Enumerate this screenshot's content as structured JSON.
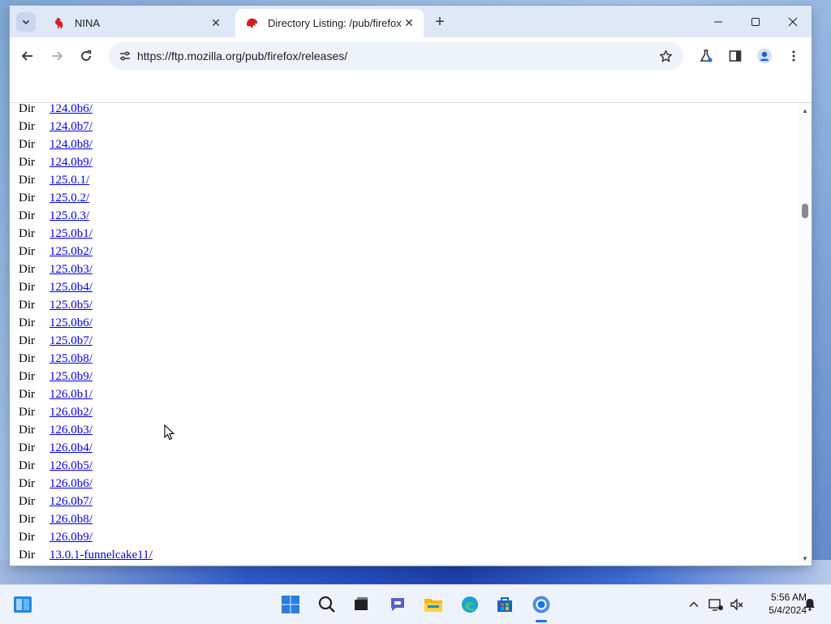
{
  "tabs": [
    {
      "title": "NINA",
      "active": false
    },
    {
      "title": "Directory Listing: /pub/firefox/",
      "active": true
    }
  ],
  "address_bar": {
    "url": "https://ftp.mozilla.org/pub/firefox/releases/"
  },
  "listing": [
    {
      "kind": "Dir",
      "name": "124.0b6/"
    },
    {
      "kind": "Dir",
      "name": "124.0b7/"
    },
    {
      "kind": "Dir",
      "name": "124.0b8/"
    },
    {
      "kind": "Dir",
      "name": "124.0b9/"
    },
    {
      "kind": "Dir",
      "name": "125.0.1/"
    },
    {
      "kind": "Dir",
      "name": "125.0.2/"
    },
    {
      "kind": "Dir",
      "name": "125.0.3/"
    },
    {
      "kind": "Dir",
      "name": "125.0b1/"
    },
    {
      "kind": "Dir",
      "name": "125.0b2/"
    },
    {
      "kind": "Dir",
      "name": "125.0b3/"
    },
    {
      "kind": "Dir",
      "name": "125.0b4/"
    },
    {
      "kind": "Dir",
      "name": "125.0b5/"
    },
    {
      "kind": "Dir",
      "name": "125.0b6/"
    },
    {
      "kind": "Dir",
      "name": "125.0b7/"
    },
    {
      "kind": "Dir",
      "name": "125.0b8/"
    },
    {
      "kind": "Dir",
      "name": "125.0b9/"
    },
    {
      "kind": "Dir",
      "name": "126.0b1/"
    },
    {
      "kind": "Dir",
      "name": "126.0b2/"
    },
    {
      "kind": "Dir",
      "name": "126.0b3/"
    },
    {
      "kind": "Dir",
      "name": "126.0b4/"
    },
    {
      "kind": "Dir",
      "name": "126.0b5/"
    },
    {
      "kind": "Dir",
      "name": "126.0b6/"
    },
    {
      "kind": "Dir",
      "name": "126.0b7/"
    },
    {
      "kind": "Dir",
      "name": "126.0b8/"
    },
    {
      "kind": "Dir",
      "name": "126.0b9/"
    },
    {
      "kind": "Dir",
      "name": "13.0.1-funnelcake11/"
    }
  ],
  "taskbar": {
    "pinned": [
      "start-icon",
      "search-icon",
      "task-view-icon",
      "teams-chat-icon",
      "file-explorer-icon",
      "edge-icon",
      "store-icon",
      "chrome-icon"
    ],
    "widgets": "widgets-icon"
  },
  "system_tray": {
    "time": "5:56 AM",
    "date": "5/4/2024"
  },
  "colors": {
    "link": "#0000ee",
    "tabstrip": "#dfe8f7",
    "accent": "#1a73e8"
  }
}
